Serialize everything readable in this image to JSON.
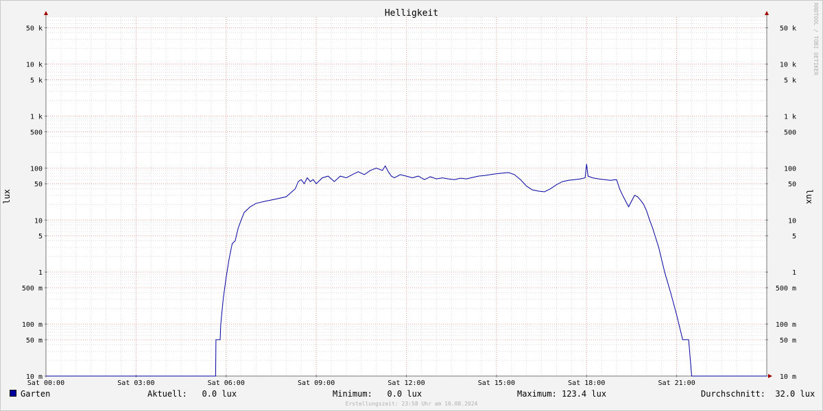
{
  "chart_data": {
    "type": "line",
    "title": "Helligkeit",
    "ylabel": "lux",
    "yscale": "log",
    "ylim": [
      0.01,
      80000
    ],
    "y_ticks": [
      {
        "value": 0.01,
        "label": "10 m"
      },
      {
        "value": 0.05,
        "label": "50 m"
      },
      {
        "value": 0.1,
        "label": "100 m"
      },
      {
        "value": 0.5,
        "label": "500 m"
      },
      {
        "value": 1,
        "label": "1"
      },
      {
        "value": 5,
        "label": "5"
      },
      {
        "value": 10,
        "label": "10"
      },
      {
        "value": 50,
        "label": "50"
      },
      {
        "value": 100,
        "label": "100"
      },
      {
        "value": 500,
        "label": "500"
      },
      {
        "value": 1000,
        "label": "1 k"
      },
      {
        "value": 5000,
        "label": "5 k"
      },
      {
        "value": 10000,
        "label": "10 k"
      },
      {
        "value": 50000,
        "label": "50 k"
      }
    ],
    "xlim": [
      0,
      24
    ],
    "x_ticks": [
      {
        "value": 0,
        "label": "Sat 00:00"
      },
      {
        "value": 3,
        "label": "Sat 03:00"
      },
      {
        "value": 6,
        "label": "Sat 06:00"
      },
      {
        "value": 9,
        "label": "Sat 09:00"
      },
      {
        "value": 12,
        "label": "Sat 12:00"
      },
      {
        "value": 15,
        "label": "Sat 15:00"
      },
      {
        "value": 18,
        "label": "Sat 18:00"
      },
      {
        "value": 21,
        "label": "Sat 21:00"
      }
    ],
    "grid": true,
    "series": [
      {
        "name": "Garten",
        "color": "#0000a0",
        "x": [
          0,
          5.65,
          5.66,
          5.8,
          5.82,
          5.9,
          6.0,
          6.1,
          6.2,
          6.3,
          6.4,
          6.5,
          6.6,
          6.8,
          7.0,
          7.3,
          7.6,
          8.0,
          8.3,
          8.4,
          8.5,
          8.6,
          8.7,
          8.8,
          8.9,
          9.0,
          9.2,
          9.4,
          9.6,
          9.8,
          10.0,
          10.2,
          10.4,
          10.6,
          10.8,
          11.0,
          11.2,
          11.3,
          11.4,
          11.5,
          11.6,
          11.8,
          12.0,
          12.2,
          12.4,
          12.6,
          12.8,
          13.0,
          13.2,
          13.4,
          13.6,
          13.8,
          14.0,
          14.2,
          14.4,
          14.6,
          14.8,
          15.0,
          15.2,
          15.4,
          15.6,
          15.8,
          16.0,
          16.2,
          16.4,
          16.6,
          16.8,
          17.0,
          17.2,
          17.4,
          17.6,
          17.8,
          17.95,
          18.0,
          18.05,
          18.2,
          18.4,
          18.6,
          18.8,
          19.0,
          19.1,
          19.2,
          19.4,
          19.6,
          19.7,
          19.8,
          19.9,
          20.0,
          20.1,
          20.2,
          20.4,
          20.6,
          20.8,
          21.0,
          21.2,
          21.4,
          21.5,
          21.6,
          21.7,
          21.8,
          21.9,
          22.0,
          22.1,
          22.2,
          24.0
        ],
        "y": [
          0.01,
          0.01,
          0.05,
          0.05,
          0.1,
          0.3,
          0.8,
          1.8,
          3.5,
          4.0,
          7.0,
          10.0,
          14.0,
          18.0,
          21.0,
          23.0,
          25.0,
          28.0,
          40.0,
          55.0,
          60.0,
          50.0,
          65.0,
          55.0,
          60.0,
          50.0,
          65.0,
          70.0,
          55.0,
          70.0,
          65.0,
          75.0,
          85.0,
          75.0,
          90.0,
          100.0,
          90.0,
          110.0,
          85.0,
          70.0,
          65.0,
          75.0,
          70.0,
          65.0,
          70.0,
          60.0,
          68.0,
          62.0,
          65.0,
          62.0,
          60.0,
          64.0,
          62.0,
          66.0,
          70.0,
          72.0,
          75.0,
          78.0,
          80.0,
          82.0,
          75.0,
          60.0,
          45.0,
          38.0,
          36.0,
          35.0,
          40.0,
          48.0,
          55.0,
          58.0,
          60.0,
          62.0,
          65.0,
          120.0,
          70.0,
          65.0,
          62.0,
          60.0,
          58.0,
          60.0,
          40.0,
          30.0,
          18.0,
          30.0,
          28.0,
          24.0,
          20.0,
          15.0,
          10.0,
          7.0,
          3.0,
          1.0,
          0.4,
          0.15,
          0.05,
          0.05,
          0.01,
          0.01,
          0.01,
          0.01,
          0.01,
          0.01,
          0.01,
          0.01,
          0.01
        ]
      }
    ]
  },
  "legend": {
    "series_name": "Garten",
    "swatch_color": "#0000a0",
    "aktuell": "Aktuell:   0.0 lux",
    "minimum": "Minimum:   0.0 lux",
    "maximum": "Maximum: 123.4 lux",
    "durchschnitt": "Durchschnitt:  32.0 lux"
  },
  "footer": {
    "created": "Erstellungszeit: 23:58 Uhr am 10.08.2024",
    "watermark": "RRDTOOL / TOBI OETIKER"
  }
}
